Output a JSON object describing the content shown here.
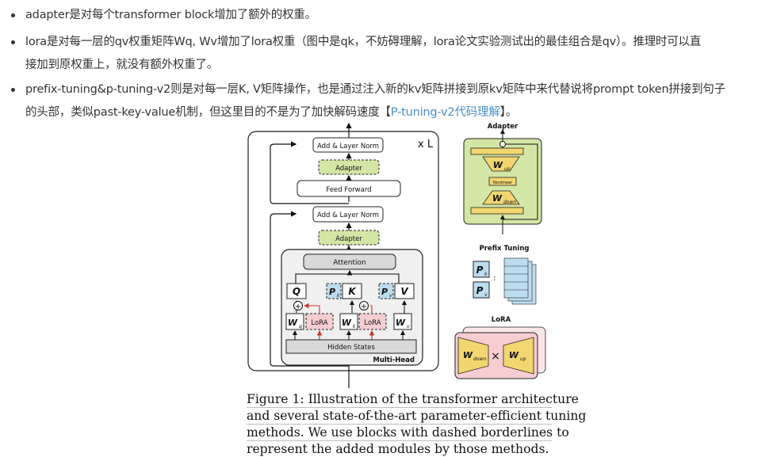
{
  "bullets": [
    {
      "text": "adapter是对每个transformer block增加了额外的权重。"
    },
    {
      "line1": "lora是对每一层的qv权重矩阵Wq, Wv增加了lora权重（图中是qk，不妨碍理解，lora论文实验测试出的最佳组合是qv）。推理时可以直",
      "line2": "接加到原权重上，就没有额外权重了。"
    },
    {
      "line1": "prefix-tuning&p-tuning-v2则是对每一层K, V矩阵操作，也是通过注入新的kv矩阵拼接到原kv矩阵中来代替说将prompt token拼接到句子",
      "line2_pre": "的头部，类似past-key-value机制，但这里目的不是为了加快解码速度【",
      "link": "P-tuning-v2代码理解",
      "line2_post": "】。"
    }
  ],
  "figure": {
    "add_norm": "Add & Layer Norm",
    "adapter": "Adapter",
    "feed_forward": "Feed Forward",
    "attention": "Attention",
    "repeat": "x L",
    "hidden_states": "Hidden States",
    "multi_head": "Multi-Head",
    "lora": "LoRA",
    "q": "Q",
    "k": "K",
    "v": "V",
    "p": "P",
    "w": "W",
    "sub_q": "q",
    "sub_k": "k",
    "sub_v": "v",
    "sub_up": "up",
    "sub_down": "down",
    "adapter_title": "Adapter",
    "nonlinear": "Nonlinear",
    "prefix_title": "Prefix Tuning",
    "lora_title": "LoRA",
    "colon": ":",
    "times": "×",
    "plus": "+"
  },
  "caption": {
    "lines": [
      "Figure 1:  Illustration of the transformer architecture",
      "and several state-of-the-art parameter-efficient tuning",
      "methods.  We use blocks with dashed borderlines to",
      "represent the added modules by those methods."
    ]
  },
  "colors": {
    "text": "#333333",
    "link": "#4a8fc7",
    "adapter_green": "#d4e6a5",
    "prefix_blue": "#bcdcf0",
    "lora_pink": "#f6cdd0",
    "trapezoid_yellow": "#f2d670",
    "gray_box": "#d9d9d9"
  }
}
